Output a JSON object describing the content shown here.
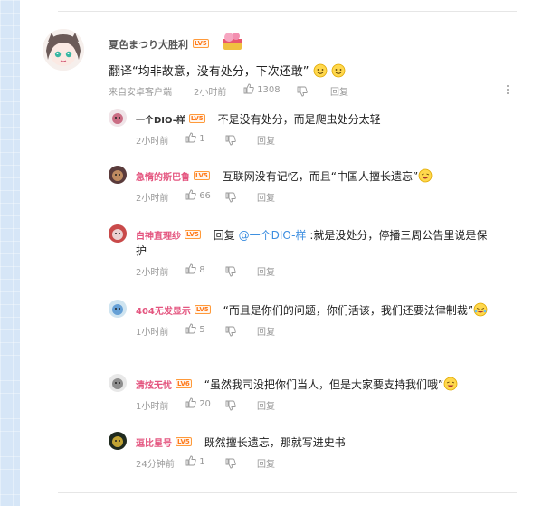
{
  "main_comment": {
    "username": "夏色まつり大胜利",
    "level": "LV5",
    "text": "翻译“均非故意，没有处分，下次还敢”",
    "source": "来自安卓客户端",
    "time": "2小时前",
    "likes": "1308",
    "reply_label": "回复"
  },
  "replies": [
    {
      "username": "一个DIO-样",
      "level": "LV5",
      "text": "不是没有处分，而是爬虫处分太轻",
      "time": "2小时前",
      "likes": "1",
      "reply_label": "回复",
      "name_color": "#333333"
    },
    {
      "username": "急惰的斯巴鲁",
      "level": "LV5",
      "text": "互联网没有记忆，而且“中国人擅长遗忘”",
      "time": "2小时前",
      "likes": "66",
      "reply_label": "回复",
      "name_color": "#e4557f"
    },
    {
      "username": "白神直理纱",
      "level": "LV5",
      "text_prefix": "回复 ",
      "mention": "@一个DIO-样",
      "text": " :就是没处分，停播三周公告里说是保",
      "text_line2": "护",
      "time": "2小时前",
      "likes": "8",
      "reply_label": "回复",
      "name_color": "#e4557f"
    },
    {
      "username": "404无发显示",
      "level": "LV5",
      "text": "“而且是你们的问题，你们活该，我们还要法律制裁”",
      "time": "1小时前",
      "likes": "5",
      "reply_label": "回复",
      "name_color": "#e4557f"
    },
    {
      "username": "清炫无忧",
      "level": "LV6",
      "text": "“虽然我司没把你们当人，但是大家要支持我们哦”",
      "time": "1小时前",
      "likes": "20",
      "reply_label": "回复",
      "name_color": "#e4557f"
    },
    {
      "username": "逗比星号",
      "level": "LV5",
      "text": "既然擅长遗忘，那就写进史书",
      "time": "24分钟前",
      "likes": "1",
      "reply_label": "回复",
      "name_color": "#e4557f"
    }
  ],
  "colors": {
    "accent": "#e4557f",
    "level": "#ff7a1a",
    "meta": "#999999",
    "mention": "#3c8ee0"
  }
}
